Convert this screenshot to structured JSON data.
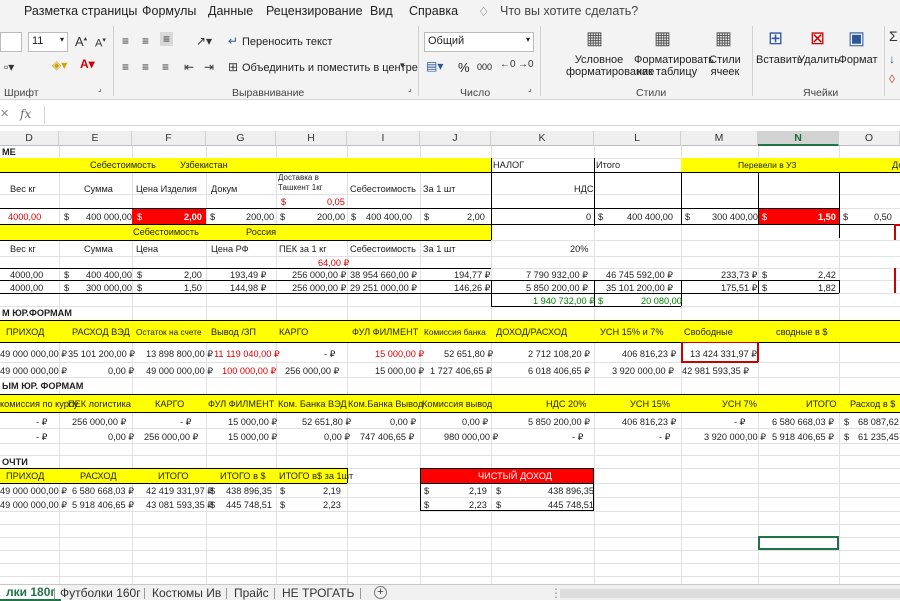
{
  "menu": [
    "Разметка страницы",
    "Формулы",
    "Данные",
    "Рецензирование",
    "Вид",
    "Справка",
    "Что вы хотите сделать?"
  ],
  "ribbon": {
    "font_size": "11",
    "wrap_text": "Переносить текст",
    "merge_center": "Объединить и поместить в центре",
    "number_format": "Общий",
    "percent": "%",
    "thousands": "000",
    "cond_format": [
      "Условное",
      "форматирование"
    ],
    "format_table": [
      "Форматировать",
      "как таблицу"
    ],
    "cell_styles": [
      "Стили",
      "ячеек"
    ],
    "insert": "Вставить",
    "delete": "Удалить",
    "format": "Формат",
    "groups": {
      "font": "Шрифт",
      "align": "Выравнивание",
      "number": "Число",
      "styles": "Стили",
      "cells": "Ячейки"
    }
  },
  "formula_bar": {
    "cancel": "✕",
    "fx": "fx",
    "value": ""
  },
  "columns": [
    "D",
    "E",
    "F",
    "G",
    "H",
    "I",
    "J",
    "K",
    "L",
    "M",
    "N",
    "O"
  ],
  "cells": {
    "r1": {
      "a": "МЕ"
    },
    "r2": {
      "seb": "Себестоимость",
      "uz": "Узбекистан",
      "nalog": "НАЛОГ",
      "itogo": "Итого",
      "perev": "Перевели в УЗ",
      "d": "До"
    },
    "r3": {
      "d": "Вес кг",
      "e": "Сумма",
      "f": "Цена Изделия",
      "g": "Докум",
      "h1": "Доставка в",
      "h2": "Ташкент 1кг",
      "i": "Себестоимость",
      "j": "За 1 шт",
      "k": "НДС"
    },
    "r4": {
      "h": "$",
      "hv": "0,05"
    },
    "r5": {
      "d": "4000,00",
      "e1": "$",
      "e": "400 000,00",
      "f1": "$",
      "f": "2,00",
      "g1": "$",
      "g": "200,00",
      "h1": "$",
      "h": "200,00",
      "i1": "$",
      "i": "400 400,00",
      "j1": "$",
      "j": "2,00",
      "k": "0",
      "l1": "$",
      "l": "400 400,00",
      "m1": "$",
      "m": "300 400,00",
      "n1": "$",
      "n": "1,50",
      "o1": "$",
      "o": "0,50"
    },
    "r6": {
      "seb": "Себестоимость",
      "ru": "Россия"
    },
    "r7": {
      "d": "Вес кг",
      "e": "Сумма",
      "f": "Цена",
      "g": "Цена РФ",
      "h": "ПЕК за 1 кг",
      "i": "Себестоимость",
      "j": "За 1 шт",
      "k": "20%"
    },
    "r8": {
      "h": "64,00 ₽"
    },
    "r9": {
      "d": "4000,00",
      "e1": "$",
      "e": "400 400,00",
      "f1": "$",
      "f": "2,00",
      "g": "193,49 ₽",
      "h": "256 000,00 ₽",
      "i": "38 954 660,00 ₽",
      "j": "194,77 ₽",
      "k": "7 790 932,00 ₽",
      "l": "46 745 592,00 ₽",
      "m": "233,73 ₽",
      "n1": "$",
      "n": "2,42"
    },
    "r10": {
      "d": "4000,00",
      "e1": "$",
      "e": "300 000,00",
      "f1": "$",
      "f": "1,50",
      "g": "144,98 ₽",
      "h": "256 000,00 ₽",
      "i": "29 251 000,00 ₽",
      "j": "146,26 ₽",
      "k": "5 850 200,00 ₽",
      "l": "35 101 200,00 ₽",
      "m": "175,51 ₽",
      "n1": "$",
      "n": "1,82"
    },
    "r11": {
      "k": "1 940 732,00 ₽",
      "l1": "$",
      "l": "20 080,00"
    },
    "r12": {
      "a": "М ЮР.ФОРМАМ"
    },
    "r13": {
      "a": "ПРИХОД",
      "b": "РАСХОД ВЭД",
      "c": "Остаток на счете",
      "d": "Вывод /ЗП",
      "e": "КАРГО",
      "f": "ФУЛ ФИЛМЕНТ",
      "g": "Комиссия банка",
      "h": "ДОХОД/РАСХОД",
      "i": "УСН 15% и 7%",
      "j": "Свободные",
      "k": "сводные в $"
    },
    "r14": {
      "a": "49 000 000,00 ₽",
      "b": "35 101 200,00 ₽",
      "c": "13 898 800,00 ₽",
      "d": "11 119 040,00 ₽",
      "e": "-  ₽",
      "f": "15 000,00 ₽",
      "g": "52 651,80 ₽",
      "h": "2 712 108,20 ₽",
      "i": "406 816,23 ₽",
      "j": "13 424 331,97 ₽"
    },
    "r15": {
      "a": "49 000 000,00 ₽",
      "b": "0,00 ₽",
      "c": "49 000 000,00 ₽",
      "d": "100 000,00 ₽",
      "e": "256 000,00 ₽",
      "f": "15 000,00 ₽",
      "g": "1 727 406,65 ₽",
      "h": "6 018 406,65 ₽",
      "i": "3 920 000,00 ₽",
      "j": "42 981 593,35 ₽"
    },
    "r16": {
      "a": "ЫМ ЮР. ФОРМАМ"
    },
    "r17": {
      "a": "комиссия по курсу",
      "b": "ПЕК логистика",
      "c": "КАРГО",
      "d": "ФУЛ ФИЛМЕНТ",
      "e": "Ком. Банка ВЭД",
      "f": "Ком.Банка Вывод",
      "g": "Комиссия вывод",
      "h": "НДС 20%",
      "i": "УСН 15%",
      "j": "УСН 7%",
      "k": "ИТОГО",
      "l": "Расход в $"
    },
    "r18": {
      "a": "-  ₽",
      "b": "256 000,00 ₽",
      "c": "-  ₽",
      "d": "15 000,00 ₽",
      "e": "52 651,80 ₽",
      "f": "0,00 ₽",
      "g": "0,00 ₽",
      "h": "5 850 200,00 ₽",
      "i": "406 816,23 ₽",
      "j": "-  ₽",
      "k": "6 580 668,03 ₽",
      "l1": "$",
      "l": "68 087,62"
    },
    "r19": {
      "a": "-  ₽",
      "b": "0,00 ₽",
      "c": "256 000,00 ₽",
      "d": "15 000,00 ₽",
      "e": "0,00 ₽",
      "f": "747 406,65 ₽",
      "g": "980 000,00 ₽",
      "h": "-  ₽",
      "i": "-  ₽",
      "j": "3 920 000,00 ₽",
      "k": "5 918 406,65 ₽",
      "l1": "$",
      "l": "61 235,45"
    },
    "r20": {
      "a": "ОЧТИ"
    },
    "r21": {
      "a": "ПРИХОД",
      "b": "РАСХОД",
      "c": "ИТОГО",
      "d": "ИТОГО в $",
      "e": "ИТОГО в$ за 1шт",
      "net": "ЧИСТЫЙ ДОХОД"
    },
    "r22": {
      "a": "49 000 000,00 ₽",
      "b": "6 580 668,03 ₽",
      "c": "42 419 331,97 ₽",
      "d1": "$",
      "d": "438 896,35",
      "e1": "$",
      "e": "2,19",
      "n1": "$",
      "n2": "2,19",
      "n3": "$",
      "n4": "438 896,35"
    },
    "r23": {
      "a": "49 000 000,00 ₽",
      "b": "5 918 406,65 ₽",
      "c": "43 081 593,35 ₽",
      "d1": "$",
      "d": "445 748,51",
      "e1": "$",
      "e": "2,23",
      "n1": "$",
      "n2": "2,23",
      "n3": "$",
      "n4": "445 748,51"
    }
  },
  "tabs": [
    "лки 180г",
    "Футболки 160г",
    "Костюмы Ив",
    "Прайс",
    "НЕ ТРОГАТЬ",
    "+"
  ],
  "colors": {
    "yellow": "#ffff00",
    "red": "#ff0000",
    "excel_green": "#217346"
  }
}
